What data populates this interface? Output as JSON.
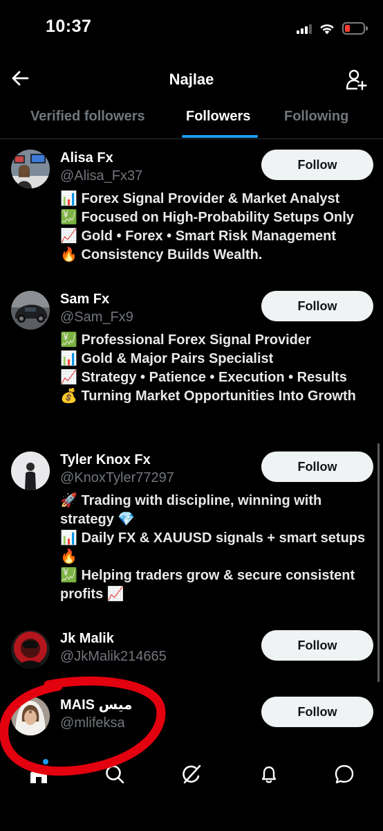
{
  "status": {
    "time": "10:37"
  },
  "header": {
    "title": "Najlae"
  },
  "tabs": [
    {
      "label": "Verified followers",
      "active": false
    },
    {
      "label": "Followers",
      "active": true
    },
    {
      "label": "Following",
      "active": false
    }
  ],
  "users": [
    {
      "name": "Alisa Fx",
      "handle": "@Alisa_Fx37",
      "follow_label": "Follow",
      "bio": [
        "📊 Forex Signal Provider & Market Analyst",
        "💹 Focused on High-Probability Setups Only",
        "📈 Gold • Forex • Smart Risk Management",
        "🔥 Consistency Builds Wealth."
      ]
    },
    {
      "name": "Sam Fx",
      "handle": "@Sam_Fx9",
      "follow_label": "Follow",
      "bio": [
        "💹 Professional Forex Signal Provider",
        "📊 Gold & Major Pairs Specialist",
        "📈 Strategy • Patience • Execution • Results",
        "💰 Turning Market Opportunities Into Growth"
      ]
    },
    {
      "name": "Tyler Knox Fx",
      "handle": "@KnoxTyler77297",
      "follow_label": "Follow",
      "bio": [
        "🚀 Trading with discipline, winning with strategy 💎",
        "📊 Daily FX & XAUUSD signals + smart setups 🔥",
        "💹 Helping traders grow & secure consistent profits 📈"
      ]
    },
    {
      "name": "Jk Malik",
      "handle": "@JkMalik214665",
      "follow_label": "Follow",
      "bio": []
    },
    {
      "name": "MAIS ميس",
      "handle": "@mlifeksa",
      "follow_label": "Follow",
      "bio": []
    }
  ],
  "nav": [
    "home-icon",
    "search-icon",
    "grok-icon",
    "notifications-icon",
    "messages-icon"
  ],
  "colors": {
    "accent": "#1d9bf0",
    "highlight_circle": "#e3000f",
    "muted_text": "#71767b"
  }
}
